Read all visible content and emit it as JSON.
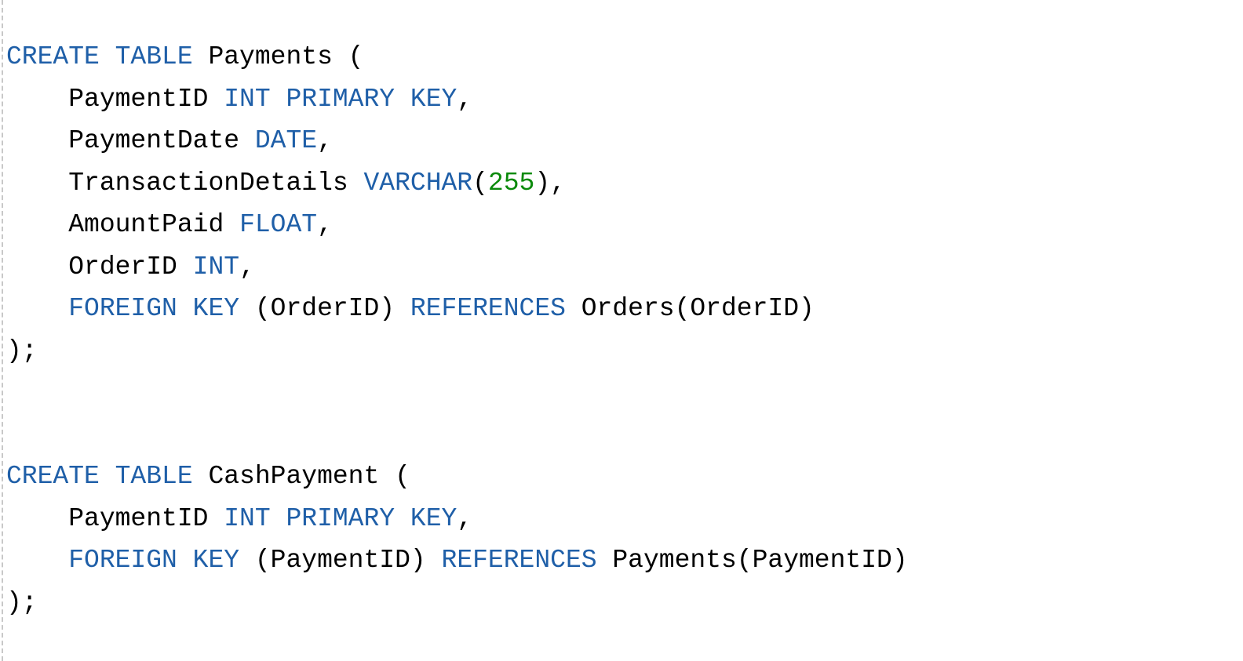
{
  "colors": {
    "keyword": "#1f5fa8",
    "number": "#0b8a0b",
    "text": "#000000",
    "background": "#ffffff"
  },
  "editor": {
    "lines": [
      [
        {
          "t": "CREATE TABLE",
          "c": "kw"
        },
        {
          "t": " Payments (",
          "c": "plain"
        }
      ],
      [
        {
          "t": "    PaymentID ",
          "c": "plain"
        },
        {
          "t": "INT PRIMARY KEY",
          "c": "kw"
        },
        {
          "t": ",",
          "c": "plain"
        }
      ],
      [
        {
          "t": "    PaymentDate ",
          "c": "plain"
        },
        {
          "t": "DATE",
          "c": "kw"
        },
        {
          "t": ",",
          "c": "plain"
        }
      ],
      [
        {
          "t": "    TransactionDetails ",
          "c": "plain"
        },
        {
          "t": "VARCHAR",
          "c": "kw"
        },
        {
          "t": "(",
          "c": "plain"
        },
        {
          "t": "255",
          "c": "num"
        },
        {
          "t": "),",
          "c": "plain"
        }
      ],
      [
        {
          "t": "    AmountPaid ",
          "c": "plain"
        },
        {
          "t": "FLOAT",
          "c": "kw"
        },
        {
          "t": ",",
          "c": "plain"
        }
      ],
      [
        {
          "t": "    OrderID ",
          "c": "plain"
        },
        {
          "t": "INT",
          "c": "kw"
        },
        {
          "t": ",",
          "c": "plain"
        }
      ],
      [
        {
          "t": "    ",
          "c": "plain"
        },
        {
          "t": "FOREIGN KEY",
          "c": "kw"
        },
        {
          "t": " (OrderID) ",
          "c": "plain"
        },
        {
          "t": "REFERENCES",
          "c": "kw"
        },
        {
          "t": " Orders(OrderID)",
          "c": "plain"
        }
      ],
      [
        {
          "t": ");",
          "c": "plain"
        }
      ],
      [],
      [],
      [
        {
          "t": "CREATE TABLE",
          "c": "kw"
        },
        {
          "t": " CashPayment (",
          "c": "plain"
        }
      ],
      [
        {
          "t": "    PaymentID ",
          "c": "plain"
        },
        {
          "t": "INT PRIMARY KEY",
          "c": "kw"
        },
        {
          "t": ",",
          "c": "plain"
        }
      ],
      [
        {
          "t": "    ",
          "c": "plain"
        },
        {
          "t": "FOREIGN KEY",
          "c": "kw"
        },
        {
          "t": " (PaymentID) ",
          "c": "plain"
        },
        {
          "t": "REFERENCES",
          "c": "kw"
        },
        {
          "t": " Payments(PaymentID)",
          "c": "plain"
        }
      ],
      [
        {
          "t": ");",
          "c": "plain"
        }
      ]
    ]
  }
}
